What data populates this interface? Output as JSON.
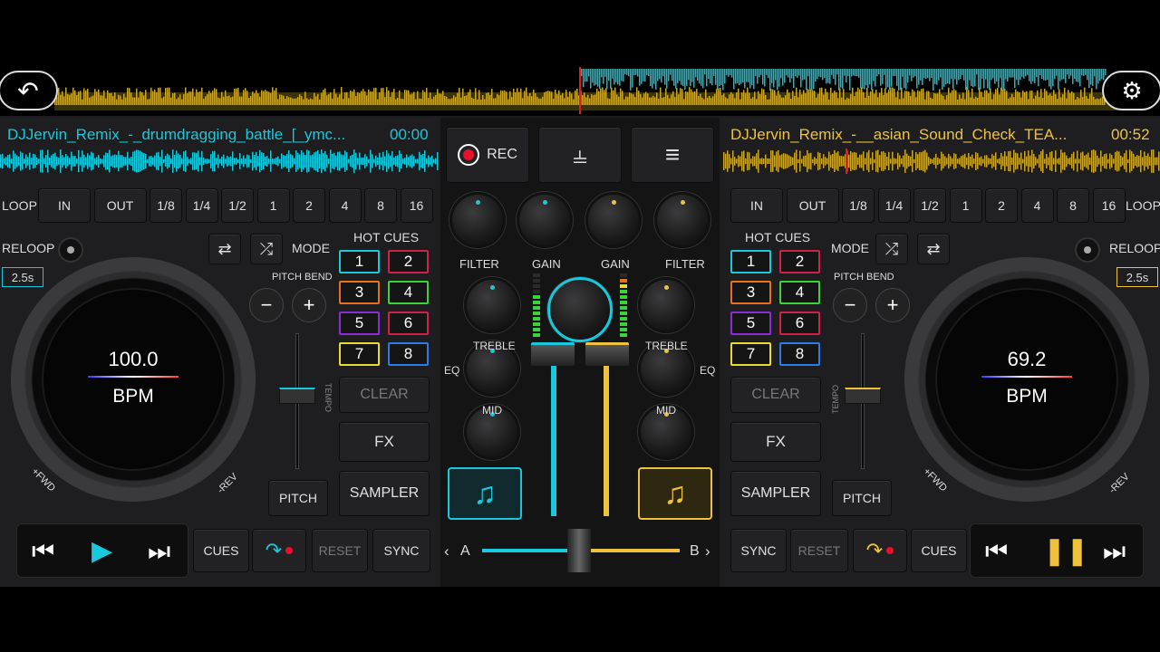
{
  "top": {
    "back_icon": "back-arrow-icon",
    "settings_icon": "gear-icon"
  },
  "deck_a": {
    "title": "DJJervin_Remix_-_drumdragging_battle_[_ymc...",
    "time": "00:00",
    "loop_label": "LOOP",
    "loop_buttons": [
      "IN",
      "OUT",
      "1/8",
      "1/4",
      "1/2",
      "1",
      "2",
      "4",
      "8",
      "16"
    ],
    "reloop_label": "RELOOP",
    "loop_len": "2.5s",
    "mode_label": "MODE",
    "pitch_bend_label": "PITCH BEND",
    "minus": "−",
    "plus": "+",
    "bpm_value": "100.0",
    "bpm_label": "BPM",
    "fwd": "+FWD",
    "rev": "-REV",
    "tempo": "TEMPO",
    "pitch": "PITCH",
    "hot_cues_label": "HOT CUES",
    "cues": [
      "1",
      "2",
      "3",
      "4",
      "5",
      "6",
      "7",
      "8"
    ],
    "clear": "CLEAR",
    "fx": "FX",
    "sampler": "SAMPLER",
    "cues_btn": "CUES",
    "reset": "RESET",
    "sync": "SYNC"
  },
  "deck_b": {
    "title": "DJJervin_Remix_-__asian_Sound_Check_TEA...",
    "time": "00:52",
    "loop_label": "LOOP",
    "loop_buttons": [
      "IN",
      "OUT",
      "1/8",
      "1/4",
      "1/2",
      "1",
      "2",
      "4",
      "8",
      "16"
    ],
    "reloop_label": "RELOOP",
    "loop_len": "2.5s",
    "mode_label": "MODE",
    "pitch_bend_label": "PITCH BEND",
    "minus": "−",
    "plus": "+",
    "bpm_value": "69.2",
    "bpm_label": "BPM",
    "fwd": "+FWD",
    "rev": "-REV",
    "tempo": "TEMPO",
    "pitch": "PITCH",
    "hot_cues_label": "HOT CUES",
    "cues": [
      "1",
      "2",
      "3",
      "4",
      "5",
      "6",
      "7",
      "8"
    ],
    "clear": "CLEAR",
    "fx": "FX",
    "sampler": "SAMPLER",
    "cues_btn": "CUES",
    "reset": "RESET",
    "sync": "SYNC"
  },
  "mixer": {
    "rec": "REC",
    "filter": "FILTER",
    "gain": "GAIN",
    "treble": "TREBLE",
    "mid": "MID",
    "eq": "EQ",
    "cross_a": "A",
    "cross_b": "B"
  },
  "colors": {
    "accent_a": "#18c8dc",
    "accent_b": "#f0c23c",
    "rec": "#e8102a"
  }
}
